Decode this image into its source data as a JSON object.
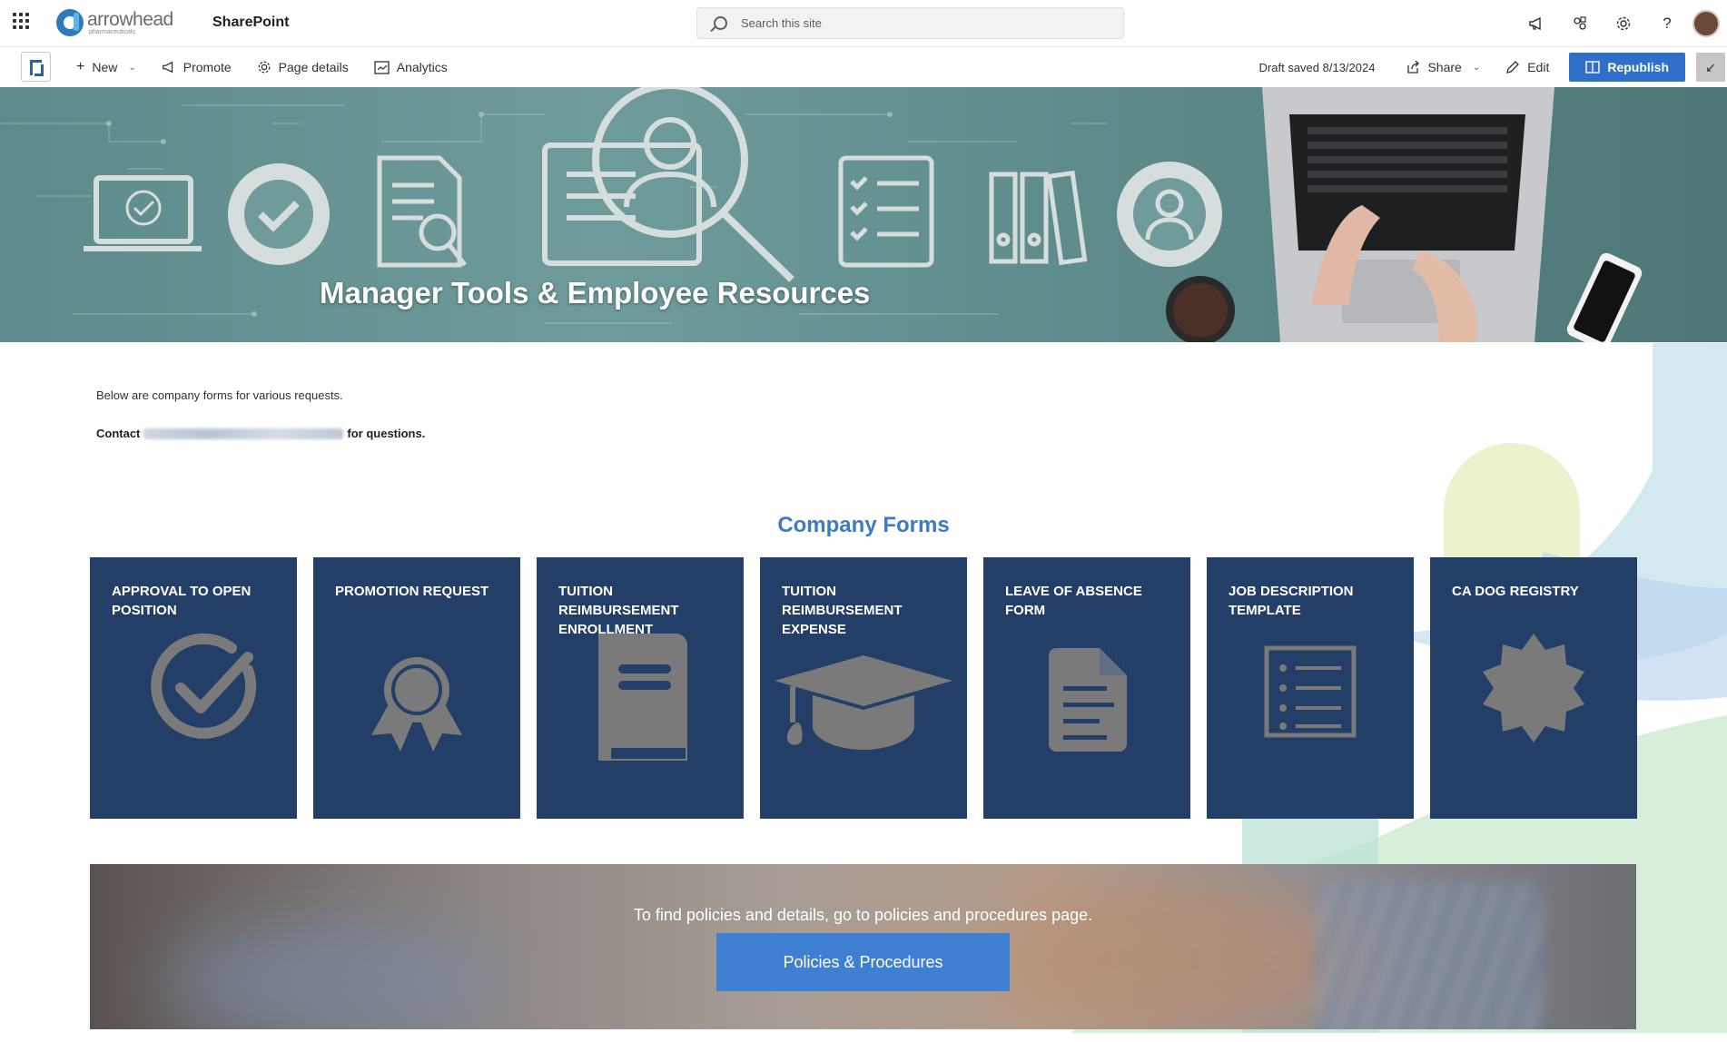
{
  "suitebar": {
    "brand_word": "arrowhead",
    "brand_sub": "pharmaceuticals",
    "app_name": "SharePoint",
    "search_placeholder": "Search this site"
  },
  "command_bar": {
    "new_label": "New",
    "promote_label": "Promote",
    "page_details_label": "Page details",
    "analytics_label": "Analytics",
    "draft_status": "Draft saved 8/13/2024",
    "share_label": "Share",
    "edit_label": "Edit",
    "republish_label": "Republish"
  },
  "hero": {
    "title": "Manager Tools & Employee Resources"
  },
  "intro": {
    "text": "Below are company forms for various requests.",
    "contact_prefix": "Contact",
    "contact_suffix": "for questions."
  },
  "section": {
    "title": "Company Forms"
  },
  "tiles": [
    {
      "label": "APPROVAL TO OPEN POSITION",
      "icon": "check-circle-icon"
    },
    {
      "label": "PROMOTION REQUEST",
      "icon": "award-ribbon-icon"
    },
    {
      "label": "TUITION REIMBURSEMENT ENROLLMENT",
      "icon": "book-icon"
    },
    {
      "label": "TUITION REIMBURSEMENT EXPENSE",
      "icon": "graduation-cap-icon"
    },
    {
      "label": "LEAVE OF ABSENCE FORM",
      "icon": "document-icon"
    },
    {
      "label": "JOB DESCRIPTION TEMPLATE",
      "icon": "list-icon"
    },
    {
      "label": "CA DOG REGISTRY",
      "icon": "badge-seal-icon"
    }
  ],
  "banner": {
    "text": "To find policies and details, go to policies and procedures page.",
    "button_label": "Policies & Procedures"
  },
  "colors": {
    "tile_bg": "#233f68",
    "icon_gray": "#7a7a7a",
    "accent_blue": "#3b7bc8",
    "republish_bg": "#2f6fc9"
  }
}
